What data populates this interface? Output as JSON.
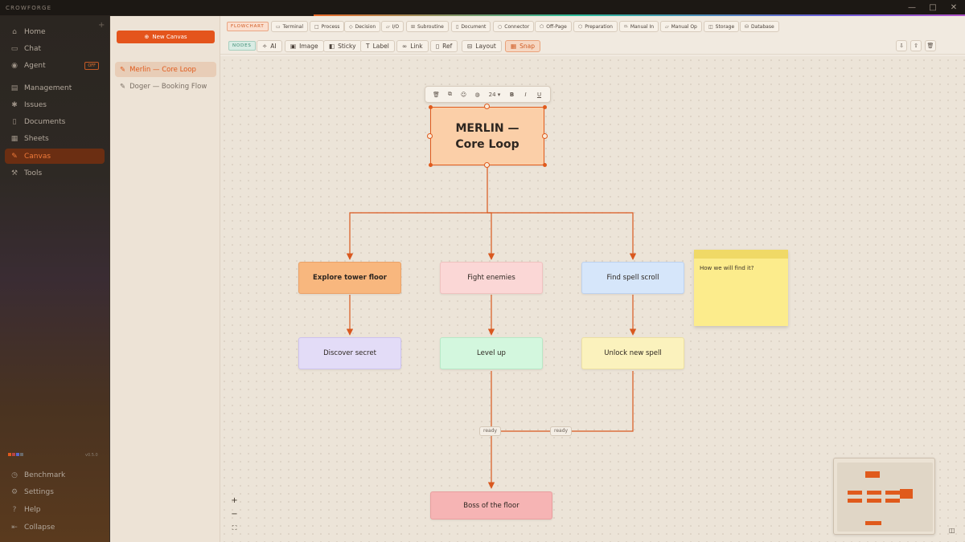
{
  "app": {
    "brand": "CROWFORGE"
  },
  "nav": {
    "items": [
      {
        "label": "Home",
        "icon": "home-icon"
      },
      {
        "label": "Chat",
        "icon": "chat-icon"
      },
      {
        "label": "Agent",
        "icon": "agent-icon",
        "badge": "OFF"
      },
      {
        "label": "Management",
        "icon": "management-icon"
      },
      {
        "label": "Issues",
        "icon": "issues-icon"
      },
      {
        "label": "Documents",
        "icon": "documents-icon"
      },
      {
        "label": "Sheets",
        "icon": "sheets-icon"
      },
      {
        "label": "Canvas",
        "icon": "canvas-icon",
        "active": true
      },
      {
        "label": "Tools",
        "icon": "tools-icon"
      }
    ],
    "version": "v0.5.0",
    "bottom": [
      {
        "label": "Benchmark",
        "icon": "benchmark-icon"
      },
      {
        "label": "Settings",
        "icon": "settings-icon"
      },
      {
        "label": "Help",
        "icon": "help-icon"
      },
      {
        "label": "Collapse",
        "icon": "collapse-icon"
      }
    ]
  },
  "canvases": {
    "new_label": "New Canvas",
    "items": [
      {
        "label": "Merlin — Core Loop",
        "active": true
      },
      {
        "label": "Doger — Booking Flow"
      }
    ]
  },
  "toolbar": {
    "flowchart_tag": "FLOWCHART",
    "shapes": [
      "Terminal",
      "Process",
      "Decision",
      "I/O",
      "Subroutine",
      "Document",
      "Connector",
      "Off-Page",
      "Preparation",
      "Manual In",
      "Manual Op",
      "Storage",
      "Database"
    ],
    "nodes_tag": "NODES",
    "tools": [
      "AI",
      "Image",
      "Sticky",
      "Label",
      "Link",
      "Ref",
      "Layout",
      "Snap"
    ],
    "active_tool": "Snap"
  },
  "node_toolbar": {
    "font_size": "24",
    "bold": "B",
    "italic": "I",
    "underline": "U"
  },
  "canvas": {
    "title_node": "MERLIN — Core Loop",
    "nodes": {
      "explore": "Explore tower floor",
      "fight": "Fight enemies",
      "find": "Find spell scroll",
      "discover": "Discover secret",
      "level": "Level up",
      "unlock": "Unlock new spell",
      "boss": "Boss of the floor"
    },
    "edge_labels": [
      "ready",
      "ready"
    ],
    "sticky": "How we will find it?"
  },
  "colors": {
    "accent": "#e05a1c",
    "explore": "#f8b77e",
    "fight": "#fbd7d6",
    "find": "#d6e6fa",
    "discover": "#e3dcf7",
    "level": "#d3f7de",
    "unlock": "#fbf2bd",
    "boss": "#f6b4b4",
    "title": "#fbcfa8"
  }
}
